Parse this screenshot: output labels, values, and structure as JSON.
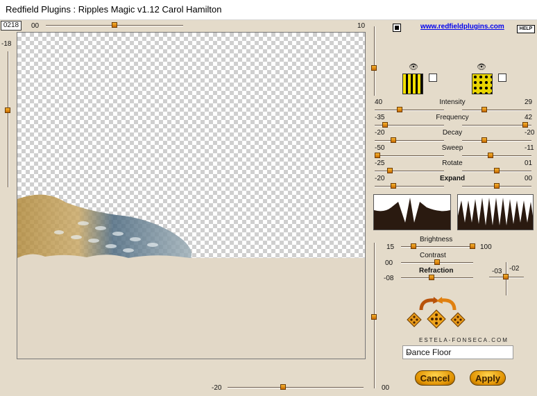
{
  "window": {
    "title": "Redfield Plugins : Ripples Magic v1.12   Carol Hamilton"
  },
  "counter": "0218",
  "link": "www.redfieldplugins.com",
  "help": "HELP",
  "top_slider": {
    "left_value": "00",
    "right_value": "10",
    "position": 0.5
  },
  "left_slider": {
    "value": "-18",
    "position": 0.45
  },
  "bottom_slider": {
    "value": "-20",
    "position": 0.4
  },
  "right_vertical_slider": {
    "value": "00",
    "position": 0.5
  },
  "params": [
    {
      "name": "Intensity",
      "left": "40",
      "right": "29",
      "left_pos": 0.35,
      "right_pos": 0.3
    },
    {
      "name": "Frequency",
      "left": "-35",
      "right": "42",
      "left_pos": 0.12,
      "right_pos": 0.95
    },
    {
      "name": "Decay",
      "left": "-20",
      "right": "-20",
      "left_pos": 0.25,
      "right_pos": 0.3
    },
    {
      "name": "Sweep",
      "left": "-50",
      "right": "-11",
      "left_pos": 0.0,
      "right_pos": 0.4
    },
    {
      "name": "Rotate",
      "left": "-25",
      "right": "01",
      "left_pos": 0.2,
      "right_pos": 0.5
    },
    {
      "name": "Expand",
      "left": "-20",
      "right": "00",
      "left_pos": 0.25,
      "right_pos": 0.5
    }
  ],
  "light": {
    "brightness": {
      "label": "Brightness",
      "left": "15",
      "right": "100",
      "left_pos": 0.15,
      "right_pos": 1.0
    },
    "contrast": {
      "label": "Contrast",
      "value": "00",
      "pos": 0.5
    },
    "refraction": {
      "label": "Refraction",
      "value": "-08",
      "pos": 0.42
    },
    "xy": {
      "x": "-03",
      "y": "-02"
    }
  },
  "credit": "ESTELA-FONSECA.COM",
  "preset": {
    "selected": "Dance Floor"
  },
  "buttons": {
    "cancel": "Cancel",
    "apply": "Apply"
  },
  "colors": {
    "accent": "#e8a21a",
    "panel": "#e4dbca"
  }
}
